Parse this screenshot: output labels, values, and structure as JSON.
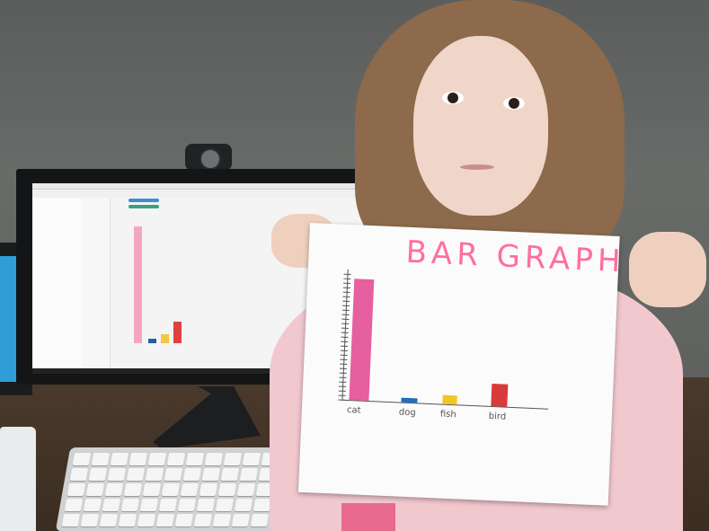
{
  "scene": {
    "description_visible_text_only": true
  },
  "paper": {
    "title": "BAR GRAPH",
    "colors": {
      "title": "#ff6ea1",
      "axis": "#555555"
    },
    "chart_data": {
      "type": "bar",
      "title": "BAR GRAPH",
      "xlabel": "",
      "ylabel": "",
      "categories": [
        "cat",
        "dog",
        "fish",
        "bird"
      ],
      "values": [
        27,
        1,
        2,
        5
      ],
      "colors": [
        "#e65f9e",
        "#1f6fc0",
        "#f2c623",
        "#d93a3a"
      ],
      "ylim": [
        0,
        28
      ],
      "grid": false
    }
  },
  "monitor_screen": {
    "app": "tableau-like",
    "chart_values": [
      27,
      1,
      2,
      5
    ],
    "chart_colors": [
      "#f4a6bf",
      "#2a5ba8",
      "#f5c543",
      "#e0403e"
    ]
  },
  "icons": [
    "webcam-icon"
  ]
}
